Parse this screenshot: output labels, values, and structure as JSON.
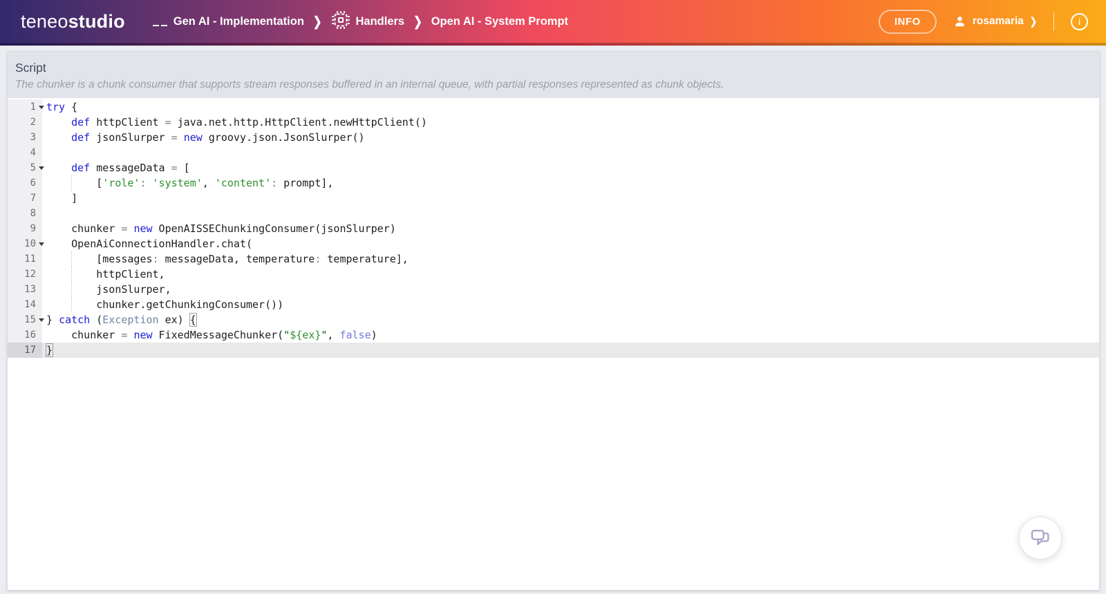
{
  "topbar": {
    "logo": {
      "light": "teneo",
      "bold": "studio"
    },
    "breadcrumb": [
      {
        "label": "Gen AI - Implementation",
        "icon": "solution-icon"
      },
      {
        "label": "Handlers",
        "icon": "chip-icon"
      },
      {
        "label": "Open AI - System Prompt",
        "icon": null
      }
    ],
    "separator": "❯",
    "info_button": "INFO",
    "user": {
      "name": "rosamaria",
      "chevron": "❯"
    },
    "info_circle": "i"
  },
  "panel": {
    "title": "Script",
    "description": "The chunker is a chunk consumer that supports stream responses buffered in an internal queue, with partial responses represented as chunk objects."
  },
  "editor": {
    "language": "groovy",
    "active_line": 17,
    "lines": [
      {
        "n": 1,
        "fold": true,
        "t": [
          [
            "k",
            "try"
          ],
          [
            "p",
            " {"
          ]
        ]
      },
      {
        "n": 2,
        "t": [
          [
            "p",
            "    "
          ],
          [
            "k",
            "def"
          ],
          [
            "p",
            " httpClient "
          ],
          [
            "o",
            "="
          ],
          [
            "p",
            " java.net.http.HttpClient.newHttpClient()"
          ]
        ]
      },
      {
        "n": 3,
        "t": [
          [
            "p",
            "    "
          ],
          [
            "k",
            "def"
          ],
          [
            "p",
            " jsonSlurper "
          ],
          [
            "o",
            "="
          ],
          [
            "p",
            " "
          ],
          [
            "k",
            "new"
          ],
          [
            "p",
            " groovy.json.JsonSlurper()"
          ]
        ]
      },
      {
        "n": 4,
        "t": []
      },
      {
        "n": 5,
        "fold": true,
        "t": [
          [
            "p",
            "    "
          ],
          [
            "k",
            "def"
          ],
          [
            "p",
            " messageData "
          ],
          [
            "o",
            "="
          ],
          [
            "p",
            " ["
          ]
        ]
      },
      {
        "n": 6,
        "guide": true,
        "t": [
          [
            "p",
            "        ["
          ],
          [
            "s",
            "'role'"
          ],
          [
            "o",
            ":"
          ],
          [
            "p",
            " "
          ],
          [
            "s",
            "'system'"
          ],
          [
            "p",
            ", "
          ],
          [
            "s",
            "'content'"
          ],
          [
            "o",
            ":"
          ],
          [
            "p",
            " prompt],"
          ]
        ]
      },
      {
        "n": 7,
        "t": [
          [
            "p",
            "    ]"
          ]
        ]
      },
      {
        "n": 8,
        "t": []
      },
      {
        "n": 9,
        "t": [
          [
            "p",
            "    chunker "
          ],
          [
            "o",
            "="
          ],
          [
            "p",
            " "
          ],
          [
            "k",
            "new"
          ],
          [
            "p",
            " OpenAISSEChunkingConsumer(jsonSlurper)"
          ]
        ]
      },
      {
        "n": 10,
        "fold": true,
        "t": [
          [
            "p",
            "    OpenAiConnectionHandler.chat("
          ]
        ]
      },
      {
        "n": 11,
        "guide": true,
        "t": [
          [
            "p",
            "        [messages"
          ],
          [
            "o",
            ":"
          ],
          [
            "p",
            " messageData, temperature"
          ],
          [
            "o",
            ":"
          ],
          [
            "p",
            " temperature],"
          ]
        ]
      },
      {
        "n": 12,
        "guide": true,
        "t": [
          [
            "p",
            "        httpClient,"
          ]
        ]
      },
      {
        "n": 13,
        "guide": true,
        "t": [
          [
            "p",
            "        jsonSlurper,"
          ]
        ]
      },
      {
        "n": 14,
        "guide": true,
        "t": [
          [
            "p",
            "        chunker.getChunkingConsumer())"
          ]
        ]
      },
      {
        "n": 15,
        "fold": true,
        "t": [
          [
            "p",
            "} "
          ],
          [
            "k",
            "catch"
          ],
          [
            "p",
            " ("
          ],
          [
            "t",
            "Exception"
          ],
          [
            "p",
            " ex) "
          ],
          [
            "m",
            "{"
          ]
        ]
      },
      {
        "n": 16,
        "t": [
          [
            "p",
            "    chunker "
          ],
          [
            "o",
            "="
          ],
          [
            "p",
            " "
          ],
          [
            "k",
            "new"
          ],
          [
            "p",
            " FixedMessageChunker("
          ],
          [
            "sd",
            "\""
          ],
          [
            "s",
            "${ex}"
          ],
          [
            "sd",
            "\""
          ],
          [
            "p",
            ", "
          ],
          [
            "b",
            "false"
          ],
          [
            "p",
            ")"
          ]
        ]
      },
      {
        "n": 17,
        "t": [
          [
            "m",
            "}"
          ]
        ]
      }
    ]
  },
  "icons": {
    "solution": "solution-icon",
    "chip": "chip-icon",
    "user": "user-icon",
    "info": "info-circle-icon",
    "chat": "chat-bubbles-icon",
    "fold": "fold-marker-icon"
  },
  "colors": {
    "topbar_gradient": [
      "#312a6b",
      "#8c3a6e",
      "#ef4a5e",
      "#f97131",
      "#fbab18"
    ],
    "page_bg": "#ebedf1",
    "header_bg": "#e2e4e9",
    "gutter_bg": "#f0f0f3",
    "active_line_bg": "#e9e9ea",
    "syntax": {
      "k": "#1d1dd6",
      "p": "#1e1e1e",
      "o": "#7d7d7d",
      "s": "#2f8f2f",
      "sd": "#1a5c1a",
      "t": "#6e87a6",
      "b": "#7478d6"
    }
  }
}
